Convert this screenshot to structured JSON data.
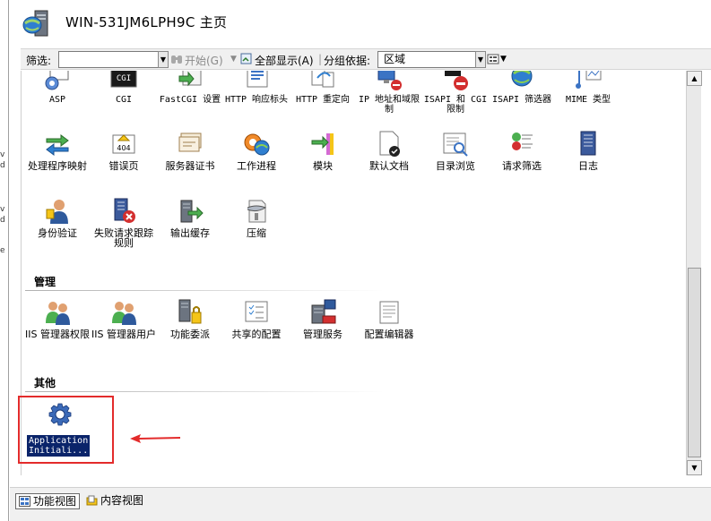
{
  "window": {
    "title": "WIN-531JM6LPH9C 主页"
  },
  "toolbar": {
    "filter_label": "筛选:",
    "filter_value": "",
    "start_label": "开始(G)",
    "show_all_label": "全部显示(A)",
    "group_by_label": "分组依据:",
    "group_by_value": "区域"
  },
  "row1": [
    {
      "label": "ASP",
      "icon": "asp-icon"
    },
    {
      "label": "CGI",
      "icon": "cgi-icon"
    },
    {
      "label": "FastCGI 设置",
      "icon": "fastcgi-icon"
    },
    {
      "label": "HTTP 响应标头",
      "icon": "http-headers-icon"
    },
    {
      "label": "HTTP 重定向",
      "icon": "http-redirect-icon"
    },
    {
      "label": "IP 地址和域限制",
      "icon": "ip-restrictions-icon"
    },
    {
      "label": "ISAPI 和 CGI 限制",
      "icon": "isapi-cgi-icon"
    },
    {
      "label": "ISAPI 筛选器",
      "icon": "isapi-filter-icon"
    },
    {
      "label": "MIME 类型",
      "icon": "mime-icon"
    }
  ],
  "row2": [
    {
      "label": "处理程序映射",
      "icon": "handler-mapping-icon"
    },
    {
      "label": "错误页",
      "icon": "error-page-icon"
    },
    {
      "label": "服务器证书",
      "icon": "certificate-icon"
    },
    {
      "label": "工作进程",
      "icon": "worker-process-icon"
    },
    {
      "label": "模块",
      "icon": "modules-icon"
    },
    {
      "label": "默认文档",
      "icon": "default-doc-icon"
    },
    {
      "label": "目录浏览",
      "icon": "dir-browse-icon"
    },
    {
      "label": "请求筛选",
      "icon": "request-filter-icon"
    },
    {
      "label": "日志",
      "icon": "log-icon"
    }
  ],
  "row3": [
    {
      "label": "身份验证",
      "icon": "auth-icon"
    },
    {
      "label": "失败请求跟踪规则",
      "icon": "failed-request-icon"
    },
    {
      "label": "输出缓存",
      "icon": "output-cache-icon"
    },
    {
      "label": "压缩",
      "icon": "compression-icon"
    }
  ],
  "sections": {
    "management": "管理",
    "other": "其他"
  },
  "management": [
    {
      "label": "IIS 管理器权限",
      "icon": "iis-permissions-icon"
    },
    {
      "label": "IIS 管理器用户",
      "icon": "iis-users-icon"
    },
    {
      "label": "功能委派",
      "icon": "delegation-icon"
    },
    {
      "label": "共享的配置",
      "icon": "shared-config-icon"
    },
    {
      "label": "管理服务",
      "icon": "mgmt-service-icon"
    },
    {
      "label": "配置编辑器",
      "icon": "config-editor-icon"
    }
  ],
  "other": [
    {
      "label_line1": "Application",
      "label_line2": "Initiali...",
      "icon": "gear-icon"
    }
  ],
  "bottom_tabs": {
    "features_view": "功能视图",
    "content_view": "内容视图"
  },
  "colors": {
    "selection": "#0a246a",
    "annotation": "#e32b2b"
  }
}
